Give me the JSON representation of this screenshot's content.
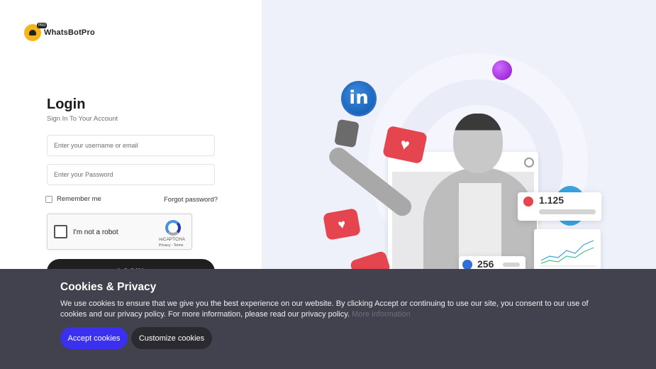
{
  "brand": {
    "name": "WhatsBotPro",
    "badge": "PRO"
  },
  "login": {
    "title": "Login",
    "subtitle": "Sign In To Your Account",
    "username_placeholder": "Enter your username or email",
    "password_placeholder": "Enter your Password",
    "remember_label": "Remember me",
    "forgot_label": "Forgot password?",
    "button_label": "LOGIN"
  },
  "captcha": {
    "label": "I'm not a robot",
    "brand": "reCAPTCHA",
    "links": "Privacy - Terms"
  },
  "illustration": {
    "linkedin_letters": "in",
    "heart_glyph": "♥",
    "stat_likes": "1.125",
    "stat_thumbs": "256"
  },
  "cookie": {
    "title": "Cookies & Privacy",
    "text": "We use cookies to ensure that we give you the best experience on our website. By clicking Accept or continuing to use our site, you consent to our use of cookies and our privacy policy. For more information, please read our privacy policy.",
    "more_link": "More information",
    "accept_label": "Accept cookies",
    "customize_label": "Customize cookies"
  },
  "colors": {
    "accent": "#3b30f0",
    "banner_bg": "#42424f",
    "right_panel_bg": "#eef0fa",
    "logo": "#f3b51a"
  }
}
